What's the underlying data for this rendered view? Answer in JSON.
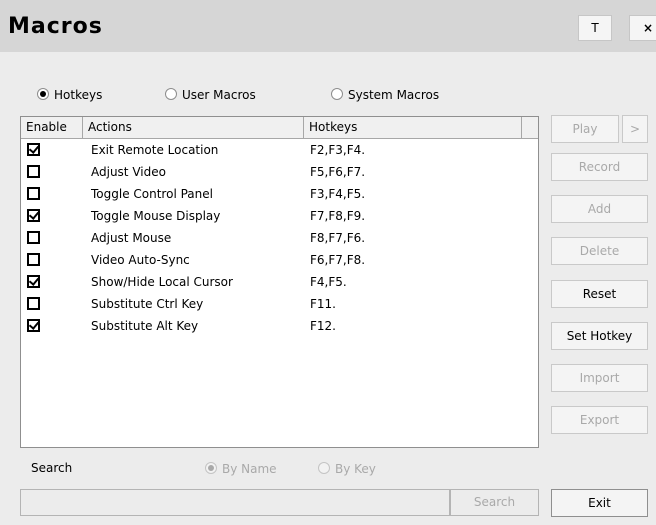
{
  "window": {
    "title": "Macros",
    "btn_t": "T",
    "btn_x": "×"
  },
  "mode": {
    "options": [
      {
        "label": "Hotkeys",
        "selected": true
      },
      {
        "label": "User Macros",
        "selected": false
      },
      {
        "label": "System Macros",
        "selected": false
      }
    ]
  },
  "table": {
    "headers": {
      "enable": "Enable",
      "actions": "Actions",
      "hotkeys": "Hotkeys"
    },
    "rows": [
      {
        "enabled": true,
        "action": "Exit Remote Location",
        "hotkeys": "F2,F3,F4."
      },
      {
        "enabled": false,
        "action": "Adjust Video",
        "hotkeys": "F5,F6,F7."
      },
      {
        "enabled": false,
        "action": "Toggle Control Panel",
        "hotkeys": "F3,F4,F5."
      },
      {
        "enabled": true,
        "action": "Toggle Mouse Display",
        "hotkeys": "F7,F8,F9."
      },
      {
        "enabled": false,
        "action": "Adjust Mouse",
        "hotkeys": "F8,F7,F6."
      },
      {
        "enabled": false,
        "action": "Video Auto-Sync",
        "hotkeys": "F6,F7,F8."
      },
      {
        "enabled": true,
        "action": "Show/Hide Local Cursor",
        "hotkeys": "F4,F5."
      },
      {
        "enabled": false,
        "action": "Substitute Ctrl Key",
        "hotkeys": "F11."
      },
      {
        "enabled": true,
        "action": "Substitute Alt Key",
        "hotkeys": "F12."
      }
    ]
  },
  "buttons": {
    "play": "Play",
    "play_more": ">",
    "record": "Record",
    "add": "Add",
    "delete": "Delete",
    "reset": "Reset",
    "set_hotkey": "Set Hotkey",
    "import": "Import",
    "export": "Export",
    "exit": "Exit"
  },
  "search": {
    "label": "Search",
    "by_name": "By Name",
    "by_key": "By Key",
    "input_value": "",
    "button": "Search"
  }
}
